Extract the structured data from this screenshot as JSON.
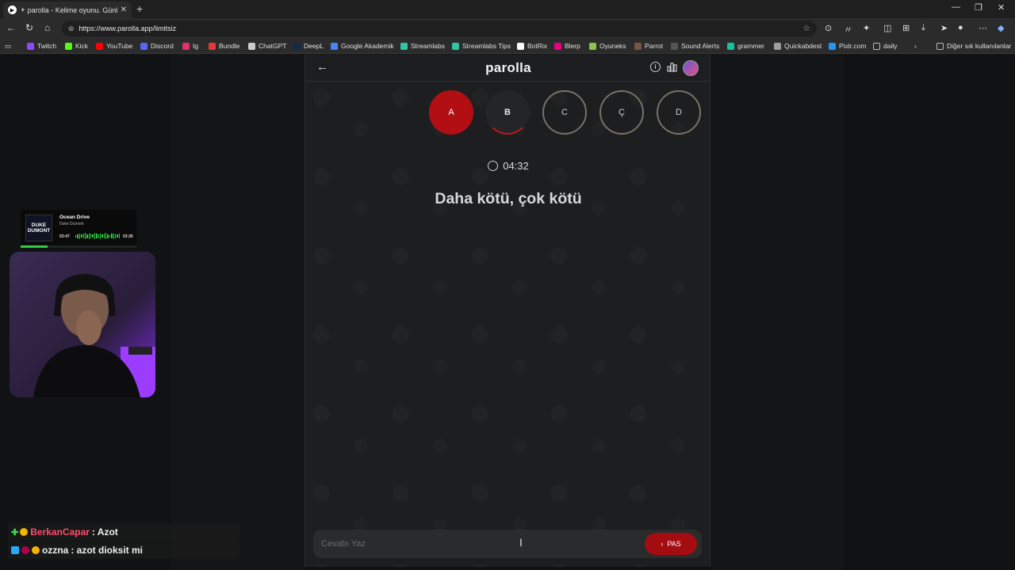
{
  "browser": {
    "tab_title": "parolla - Kelime oyunu. Günl",
    "url": "https://www.parolla.app/limitsiz",
    "bookmarks": [
      {
        "label": "Twitch",
        "color": "#9146ff"
      },
      {
        "label": "Kick",
        "color": "#53fc18"
      },
      {
        "label": "YouTube",
        "color": "#ff0000"
      },
      {
        "label": "Discord",
        "color": "#5865f2"
      },
      {
        "label": "Ig",
        "color": "#e1306c"
      },
      {
        "label": "Bundle",
        "color": "#e53935"
      },
      {
        "label": "ChatGPT",
        "color": "#cccccc"
      },
      {
        "label": "DeepL",
        "color": "#0f2b46"
      },
      {
        "label": "Google Akademik",
        "color": "#4285f4"
      },
      {
        "label": "Streamlabs",
        "color": "#31c3a2"
      },
      {
        "label": "Streamlabs Tips",
        "color": "#31c3a2"
      },
      {
        "label": "BotRix",
        "color": "#ffffff"
      },
      {
        "label": "Blerp",
        "color": "#e6007e"
      },
      {
        "label": "Oyuneks",
        "color": "#8bc34a"
      },
      {
        "label": "Parrot",
        "color": "#795548"
      },
      {
        "label": "Sound Alerts",
        "color": "#555555"
      },
      {
        "label": "grammer",
        "color": "#15c39a"
      },
      {
        "label": "Quickabdest",
        "color": "#9e9e9e"
      },
      {
        "label": "Pixlr.com",
        "color": "#2196f3"
      },
      {
        "label": "daily",
        "color": "#888888"
      }
    ],
    "other_bookmarks": "Diğer sık kullanılanlar"
  },
  "game": {
    "logo": "parolla",
    "letters": [
      {
        "label": "A",
        "state": "correct"
      },
      {
        "label": "B",
        "state": "current"
      },
      {
        "label": "C",
        "state": "pending"
      },
      {
        "label": "Ç",
        "state": "pending"
      },
      {
        "label": "D",
        "state": "pending"
      }
    ],
    "timer": "04:32",
    "question": "Daha kötü, çok kötü",
    "answer_placeholder": "Cevabı Yaz",
    "pass_label": "PAS",
    "accent_color": "#b10f14"
  },
  "music": {
    "song": "Ocean Drive",
    "artist": "Duke Dumont",
    "elapsed": "03:47",
    "total": "03:26",
    "cover_line1": "DUKE",
    "cover_line2": "DUMONT"
  },
  "chat": [
    {
      "user": "BerkanCapar",
      "message": ": Azot",
      "user_color": "#ff4d6d"
    },
    {
      "user": "ozzna",
      "message": ": azot dioksit mi",
      "user_color": "#f0f0f0"
    }
  ]
}
